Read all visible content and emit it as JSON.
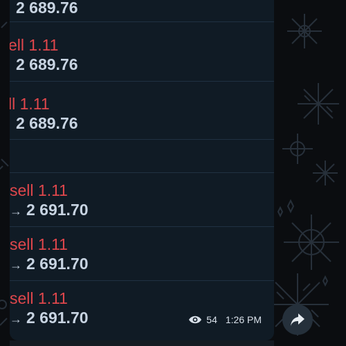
{
  "messages": [
    {
      "sell": "",
      "price": "2 689.76",
      "arrow": false
    },
    {
      "sell": "ell 1.11",
      "price": "2 689.76",
      "arrow": false
    },
    {
      "sell": "ll 1.11",
      "price": "2 689.76",
      "arrow": false
    },
    {
      "sell": "",
      "price": "",
      "arrow": false
    },
    {
      "sell": "sell 1.11",
      "price": "2 691.70",
      "arrow": true
    },
    {
      "sell": "sell 1.11",
      "price": "2 691.70",
      "arrow": true
    },
    {
      "sell": "sell 1.11",
      "price": "2 691.70",
      "arrow": true
    }
  ],
  "meta": {
    "views": "54",
    "time": "1:26 PM"
  },
  "icons": {
    "views": "eye-icon",
    "share": "share-arrow-icon"
  },
  "colors": {
    "sell": "#e0474c",
    "price": "#c8d4e2",
    "bubble": "#0f1a24",
    "background": "#0b0d10"
  }
}
